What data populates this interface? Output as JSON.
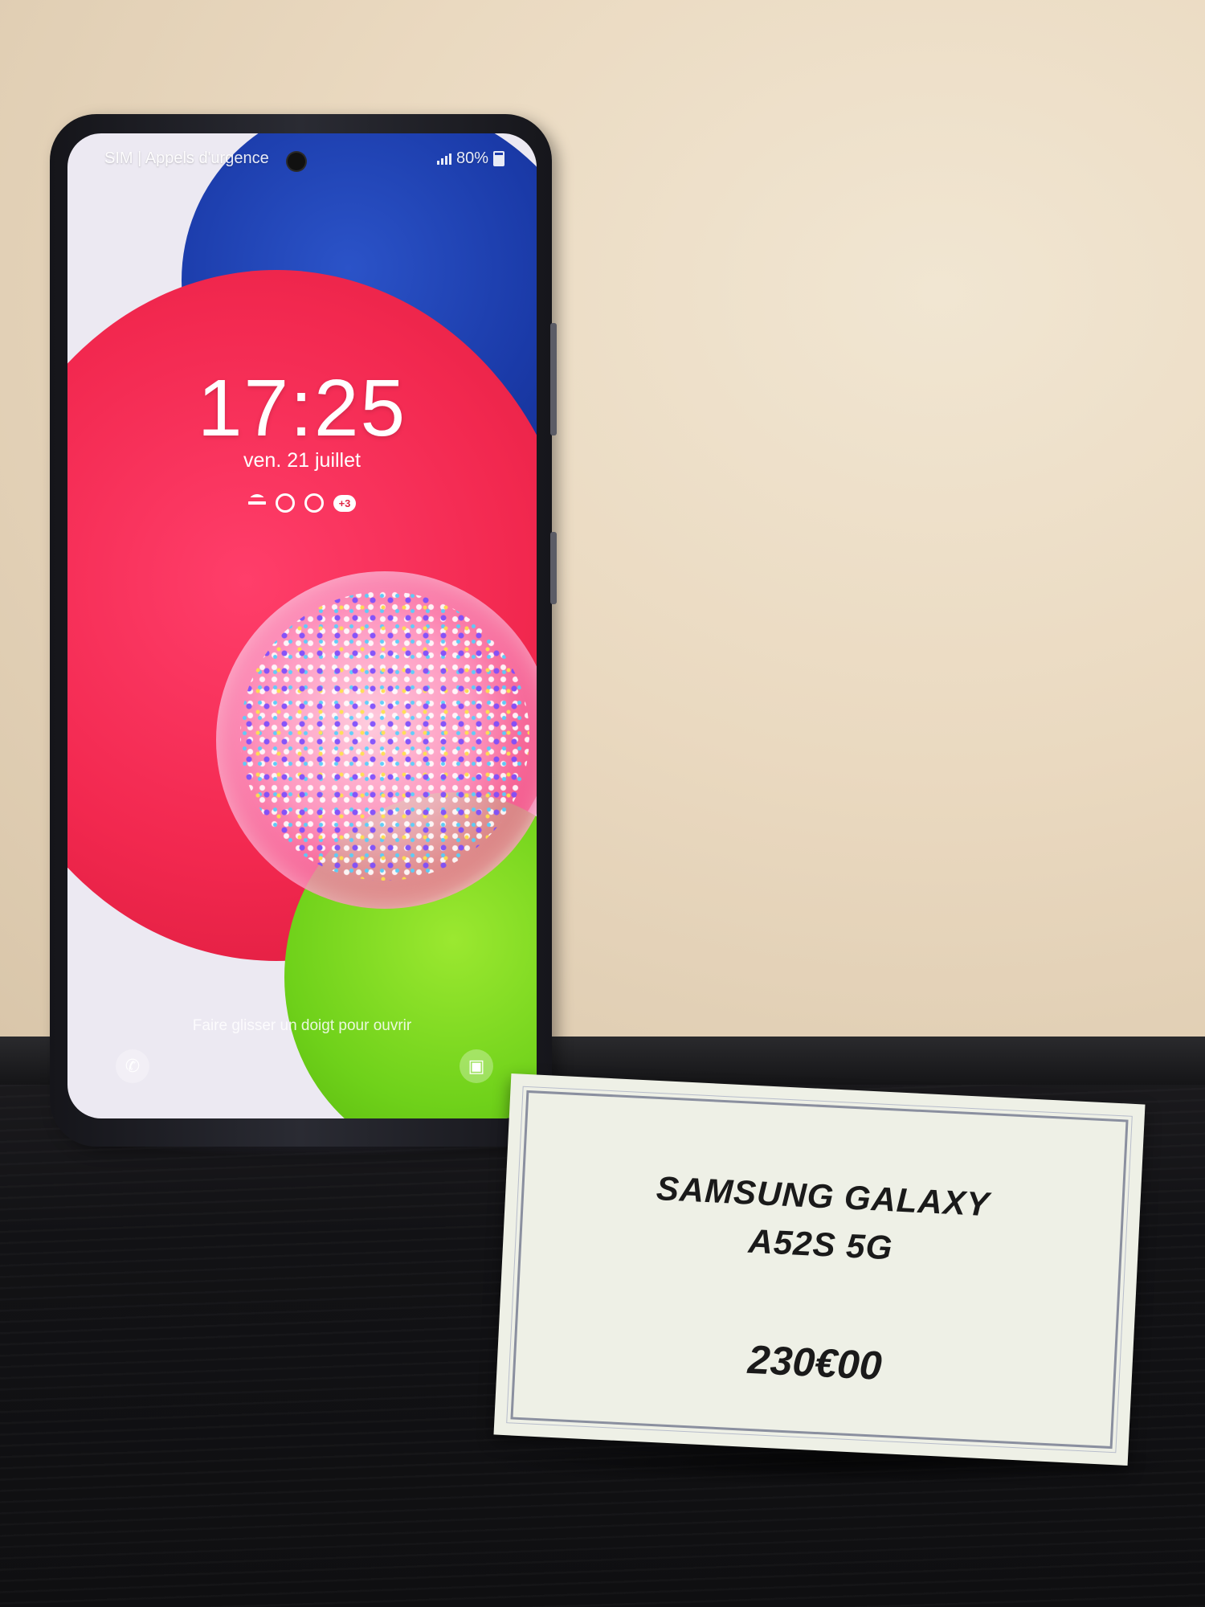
{
  "phone": {
    "status_bar": {
      "carrier_text": "SIM | Appels d'urgence",
      "battery_text": "80%"
    },
    "lock_screen": {
      "time": "17:25",
      "date": "ven. 21 juillet",
      "notifications_more": "+3",
      "swipe_hint": "Faire glisser un doigt pour ouvrir"
    }
  },
  "price_card": {
    "product_line1": "SAMSUNG GALAXY",
    "product_line2": "A52S 5G",
    "price": "230€00"
  },
  "colors": {
    "wall": "#e9dcc6",
    "table": "#121215",
    "wallpaper_blue": "#1a3aa8",
    "wallpaper_red": "#f2284f",
    "wallpaper_green": "#6fd11a",
    "card": "#eef0e6"
  }
}
